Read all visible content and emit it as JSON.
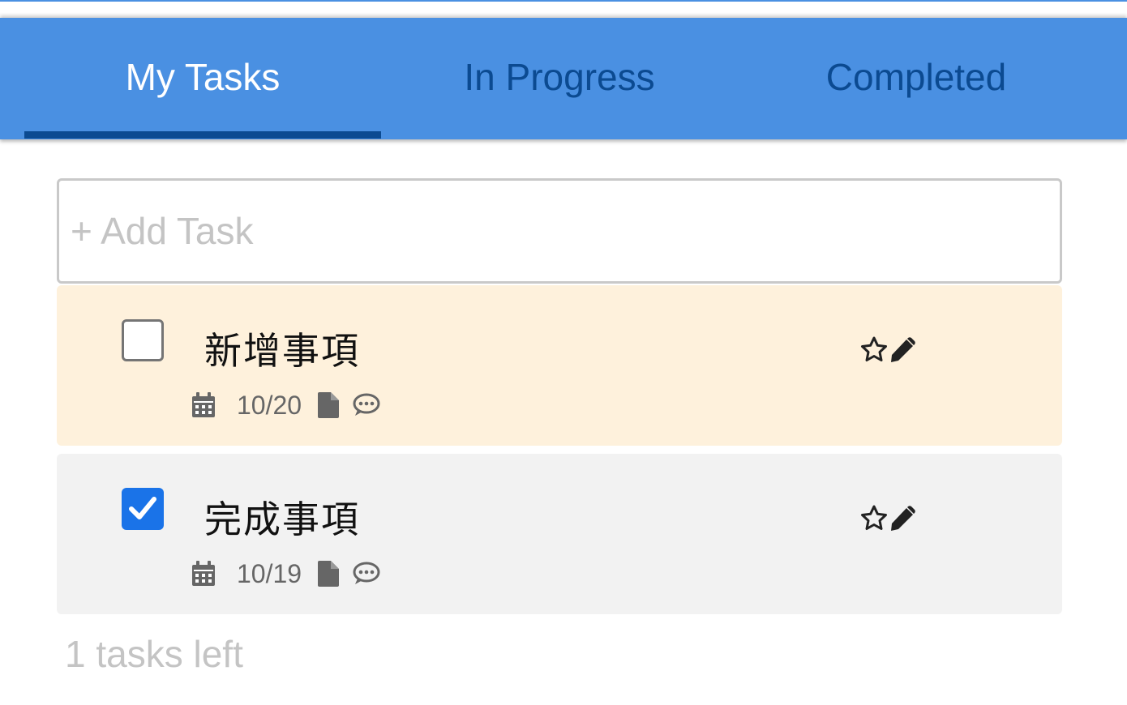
{
  "tabs": [
    {
      "label": "My Tasks",
      "active": true
    },
    {
      "label": "In Progress",
      "active": false
    },
    {
      "label": "Completed",
      "active": false
    }
  ],
  "add_task": {
    "placeholder": "+ Add Task",
    "value": ""
  },
  "tasks": [
    {
      "title": "新增事項",
      "completed": false,
      "date": "10/20",
      "icons": [
        "calendar-icon",
        "file-icon",
        "comment-icon",
        "star-icon",
        "pencil-icon"
      ]
    },
    {
      "title": "完成事項",
      "completed": true,
      "date": "10/19",
      "icons": [
        "calendar-icon",
        "file-icon",
        "comment-icon",
        "star-icon",
        "pencil-icon"
      ]
    }
  ],
  "footer": {
    "tasks_left": "1 tasks left"
  },
  "colors": {
    "header": "#4a90e2",
    "tab_active_text": "#ffffff",
    "tab_inactive_text": "#0b4a91",
    "indicator": "#0b4a91",
    "pending_task_bg": "#fef1dc",
    "completed_task_bg": "#f2f2f2",
    "checkbox_checked": "#1a73e8"
  }
}
